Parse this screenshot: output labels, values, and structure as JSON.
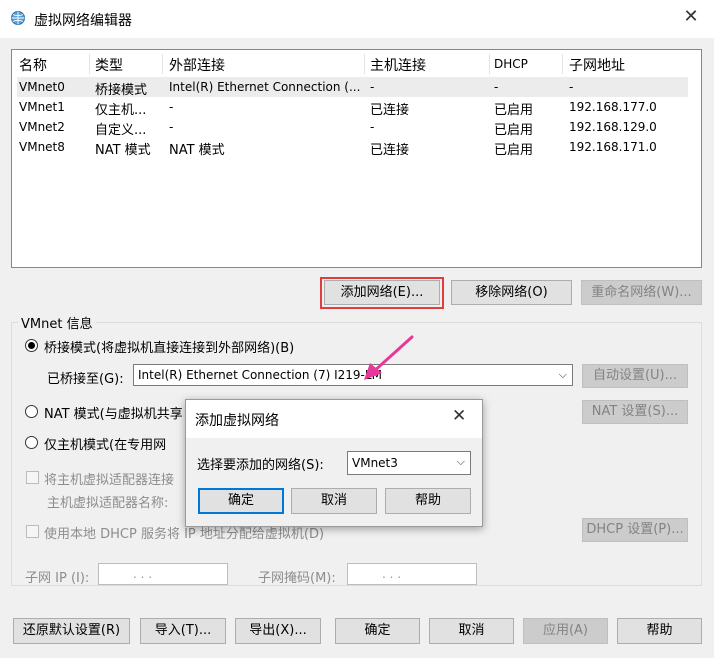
{
  "window": {
    "title": "虚拟网络编辑器",
    "close_glyph": "✕"
  },
  "table": {
    "headers": [
      "名称",
      "类型",
      "外部连接",
      "主机连接",
      "DHCP",
      "子网地址"
    ],
    "rows": [
      [
        "VMnet0",
        "桥接模式",
        "Intel(R) Ethernet Connection (...",
        "-",
        "-",
        "-"
      ],
      [
        "VMnet1",
        "仅主机...",
        "-",
        "已连接",
        "已启用",
        "192.168.177.0"
      ],
      [
        "VMnet2",
        "自定义...",
        "-",
        "-",
        "已启用",
        "192.168.129.0"
      ],
      [
        "VMnet8",
        "NAT 模式",
        "NAT 模式",
        "已连接",
        "已启用",
        "192.168.171.0"
      ]
    ]
  },
  "net_buttons": {
    "add": "添加网络(E)...",
    "remove": "移除网络(O)",
    "rename": "重命名网络(W)..."
  },
  "vmnet_info": {
    "legend": "VMnet 信息",
    "bridge_radio": "桥接模式(将虚拟机直接连接到外部网络)(B)",
    "bridged_to_label": "已桥接至(G):",
    "bridged_to_value": "Intel(R) Ethernet Connection (7) I219-LM",
    "auto_settings": "自动设置(U)...",
    "nat_radio": "NAT 模式(与虚拟机共享",
    "nat_settings": "NAT 设置(S)...",
    "hostonly_radio": "仅主机模式(在专用网",
    "connect_adapter": "将主机虚拟适配器连接",
    "adapter_name": "主机虚拟适配器名称:",
    "dhcp_check": "使用本地 DHCP 服务将 IP 地址分配给虚拟机(D)",
    "dhcp_settings": "DHCP 设置(P)...",
    "subnet_ip_label": "子网 IP (I):",
    "subnet_mask_label": "子网掩码(M):",
    "ip_placeholder": ".   .   ."
  },
  "footer": {
    "restore": "还原默认设置(R)",
    "import": "导入(T)...",
    "export": "导出(X)...",
    "ok": "确定",
    "cancel": "取消",
    "apply": "应用(A)",
    "help": "帮助"
  },
  "dialog": {
    "title": "添加虚拟网络",
    "close_glyph": "✕",
    "select_label": "选择要添加的网络(S):",
    "select_value": "VMnet3",
    "ok": "确定",
    "cancel": "取消",
    "help": "帮助"
  },
  "colors": {
    "highlight_red": "#e23d3d",
    "arrow_pink": "#e5389a",
    "focus_blue": "#0078d7"
  },
  "icons": {
    "app": "globe-network-icon",
    "dropdown": "chevron-down-icon",
    "arrow": "annotation-arrow-icon"
  }
}
